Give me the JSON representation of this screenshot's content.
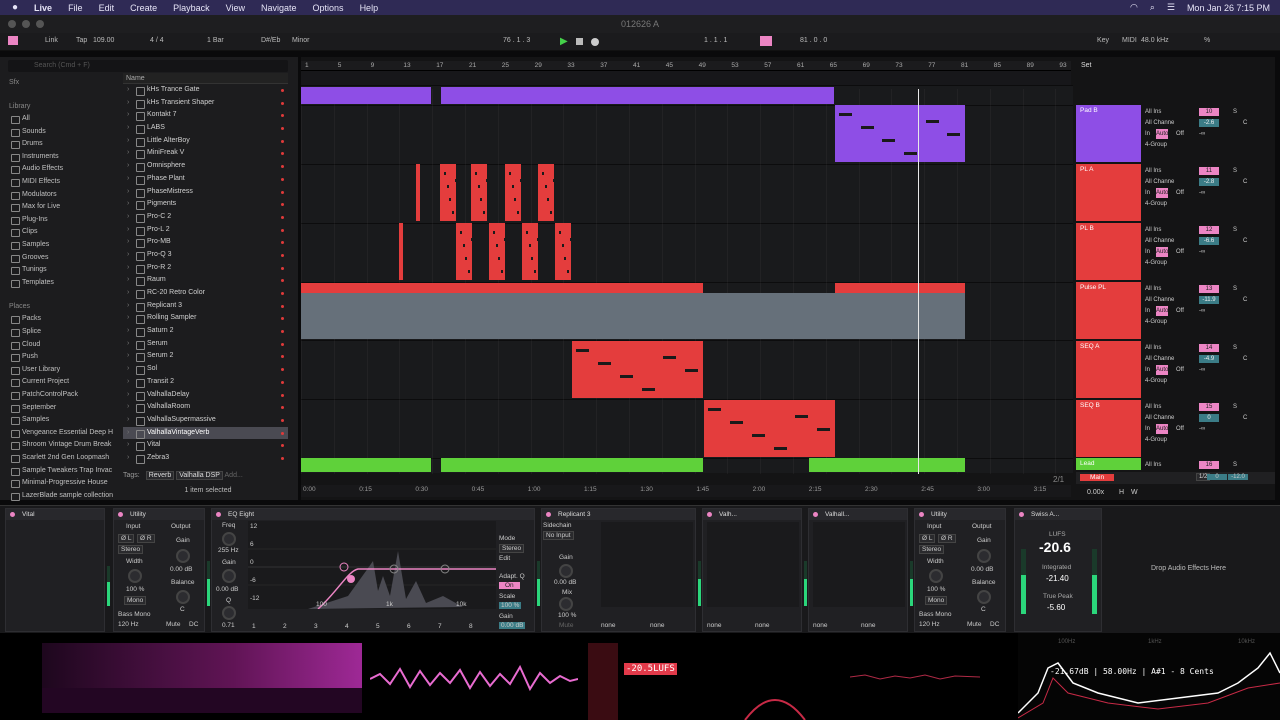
{
  "menubar": {
    "app": "Live",
    "items": [
      "File",
      "Edit",
      "Create",
      "Playback",
      "View",
      "Navigate",
      "Options",
      "Help"
    ],
    "clock": "Mon Jan 26  7:15 PM"
  },
  "window": {
    "title": "012626 A"
  },
  "control": {
    "link": "Link",
    "tap": "Tap",
    "tempo": "109.00",
    "signature": "4 / 4",
    "quantize": "1 Bar",
    "key": "D#/Eb",
    "scale": "Minor",
    "position": "76 .  1 .  3",
    "loop_start": "1 .  1 .  1",
    "loop_len": "81 .  0 .  0",
    "key_btn": "Key",
    "midi_btn": "MIDI",
    "sample_rate": "48.0 kHz",
    "cpu": "%"
  },
  "browser": {
    "search_placeholder": "Search (Cmd + F)",
    "sfx": "Sfx",
    "library_header": "Library",
    "library": [
      "All",
      "Sounds",
      "Drums",
      "Instruments",
      "Audio Effects",
      "MIDI Effects",
      "Modulators",
      "Max for Live",
      "Plug-Ins",
      "Clips",
      "Samples",
      "Grooves",
      "Tunings",
      "Templates"
    ],
    "places_header": "Places",
    "places": [
      "Packs",
      "Splice",
      "Cloud",
      "Push",
      "User Library",
      "Current Project",
      "PatchControlPack",
      "September",
      "Samples",
      "Vengeance Essential Deep H",
      "Shroom Vintage Drum Break",
      "Scarlett 2nd Gen Loopmash",
      "Sample Tweakers Trap Invac",
      "Minimal-Progressive House",
      "LazerBlade sample collection"
    ],
    "column": "Name",
    "items": [
      "kHs Trance Gate",
      "kHs Transient Shaper",
      "Kontakt 7",
      "LABS",
      "Little AlterBoy",
      "MiniFreak V",
      "Omnisphere",
      "Phase Plant",
      "PhaseMistress",
      "Pigments",
      "Pro-C 2",
      "Pro-L 2",
      "Pro-MB",
      "Pro-Q 3",
      "Pro-R 2",
      "Raum",
      "RC-20 Retro Color",
      "Replicant 3",
      "Rolling Sampler",
      "Saturn 2",
      "Serum",
      "Serum 2",
      "Sol",
      "Transit 2",
      "ValhallaDelay",
      "ValhallaRoom",
      "ValhallaSupermassive",
      "ValhallaVintageVerb",
      "Vital",
      "Zebra3"
    ],
    "selected_index": 27,
    "tags_label": "Tags:",
    "tag1": "Reverb",
    "tag2": "Valhalla DSP",
    "tag3": "Add...",
    "status": "1 item selected"
  },
  "ruler": [
    "1",
    "5",
    "9",
    "13",
    "17",
    "21",
    "25",
    "29",
    "33",
    "37",
    "41",
    "45",
    "49",
    "53",
    "57",
    "61",
    "65",
    "69",
    "73",
    "77",
    "81",
    "85",
    "89",
    "93"
  ],
  "timeline": [
    "0:00",
    "0:15",
    "0:30",
    "0:45",
    "1:00",
    "1:15",
    "1:30",
    "1:45",
    "2:00",
    "2:15",
    "2:30",
    "2:45",
    "3:00",
    "3:15"
  ],
  "set_label": "Set",
  "tracks": [
    {
      "name": "Pad B",
      "num": "10",
      "vol": "-2.6",
      "color": "#8e4ee6"
    },
    {
      "name": "PL A",
      "num": "11",
      "vol": "-2.8",
      "color": "#e43d3d"
    },
    {
      "name": "PL B",
      "num": "12",
      "vol": "-6.6",
      "color": "#e43d3d"
    },
    {
      "name": "Pulse PL",
      "num": "13",
      "vol": "-11.9",
      "color": "#e43d3d"
    },
    {
      "name": "SEQ A",
      "num": "14",
      "vol": "-4.9",
      "color": "#e43d3d"
    },
    {
      "name": "SEQ B",
      "num": "15",
      "vol": "0",
      "color": "#e43d3d"
    },
    {
      "name": "Lead",
      "num": "16",
      "vol": "-∞",
      "color": "#5fd13a"
    }
  ],
  "mixer": {
    "input": "All Ins",
    "channel": "All Channe",
    "in": "In",
    "auto": "Auto",
    "off": "Off",
    "group": "4-Group",
    "c": "C",
    "s": "S",
    "neg_inf": "-∞"
  },
  "main": {
    "name": "Main",
    "input": "1/2",
    "vol": "0",
    "peak": "-12.0",
    "count": "2/1",
    "zoom": "0.00x",
    "h": "H",
    "w": "W"
  },
  "devices": {
    "vital": "Vital",
    "utility1": {
      "title": "Utility",
      "input": "Input",
      "output": "Output",
      "phase_l": "Ø L",
      "phase_r": "Ø R",
      "stereo": "Stereo",
      "width": "Width",
      "width_val": "100 %",
      "mono": "Mono",
      "bass_mono": "Bass Mono",
      "freq": "120 Hz",
      "gain": "Gain",
      "gain_val": "0.00 dB",
      "balance": "Balance",
      "bal_val": "C",
      "mute": "Mute",
      "dc": "DC",
      "none1": "none",
      "none2": "none"
    },
    "eq": {
      "title": "EQ Eight",
      "freq": "Freq",
      "freq_val": "255 Hz",
      "gain": "Gain",
      "gain_val": "0.00 dB",
      "q": "Q",
      "q_val": "0.71",
      "mode": "Mode",
      "mode_val": "Stereo",
      "edit": "Edit",
      "adapt": "Adapt. Q",
      "on": "On",
      "scale": "Scale",
      "scale_val": "100 %",
      "gain_out": "Gain",
      "gain_out_val": "0.00 dB",
      "db_labels": [
        "12",
        "6",
        "0",
        "-6",
        "-12"
      ],
      "hz_labels": [
        "100",
        "1k",
        "10k"
      ],
      "bands": [
        "1",
        "2",
        "3",
        "4",
        "5",
        "6",
        "7",
        "8"
      ]
    },
    "replicant": {
      "title": "Replicant 3",
      "sidechain": "Sidechain",
      "sc_val": "No Input",
      "gain": "Gain",
      "gain_val": "0.00 dB",
      "mix": "Mix",
      "mix_val": "100 %",
      "mute": "Mute"
    },
    "valh1": "Valh...",
    "valh2": "Valhall...",
    "utility2": {
      "title": "Utility"
    },
    "swiss": {
      "title": "Swiss A...",
      "lufs": "LUFS",
      "lufs_val": "-20.6",
      "integrated": "Integrated",
      "int_val": "-21.40",
      "truepeak": "True Peak",
      "tp_val": "-5.60"
    },
    "drop": "Drop Audio Effects Here"
  },
  "viz": {
    "lufs_readout": "-20.5LUFS",
    "spectrum_readout": "-21.67dB | 58.00Hz | A#1 - 8 Cents",
    "hz1": "100Hz",
    "hz2": "1kHz",
    "hz3": "10kHz"
  }
}
